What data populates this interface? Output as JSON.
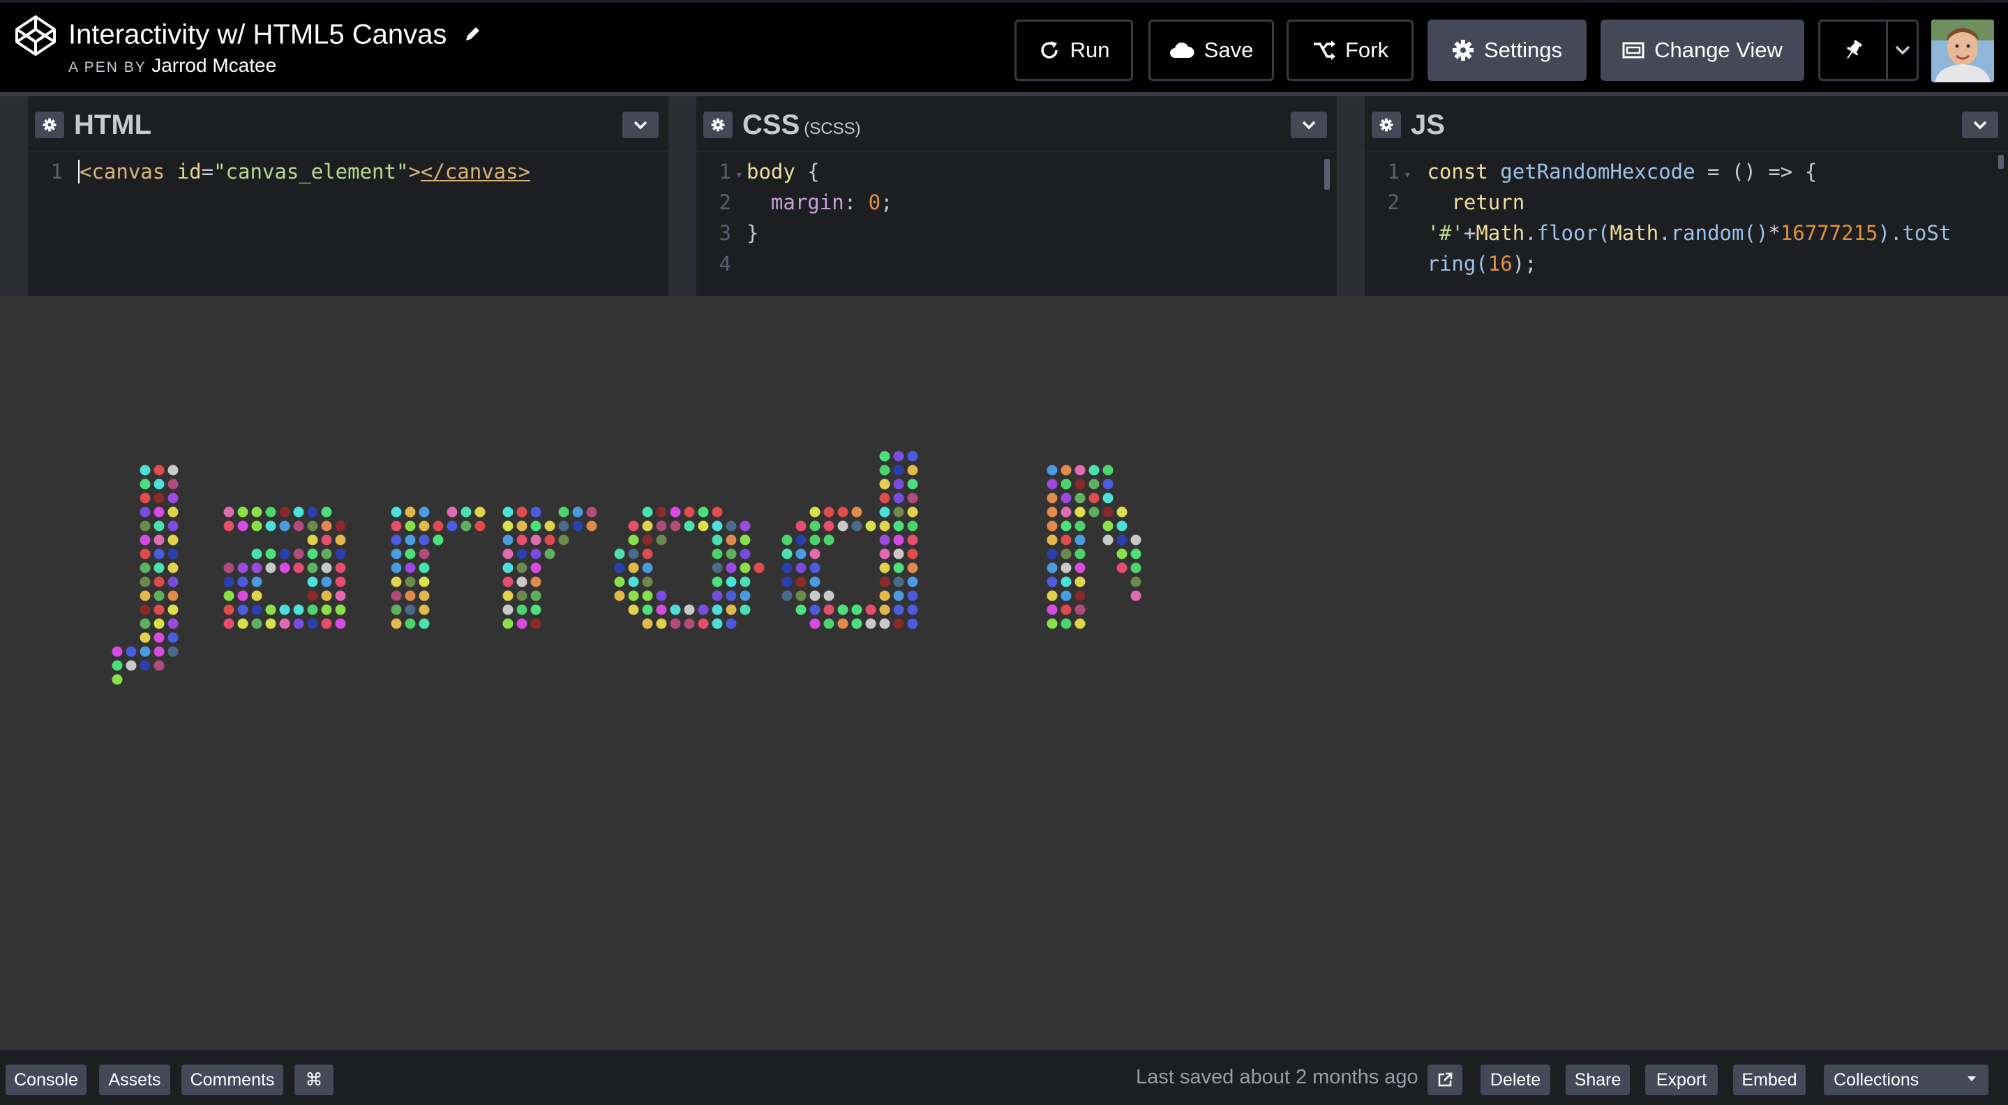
{
  "header": {
    "title": "Interactivity w/ HTML5 Canvas",
    "byline_prefix": "A PEN BY",
    "author": "Jarrod Mcatee",
    "buttons": {
      "run": "Run",
      "save": "Save",
      "fork": "Fork",
      "settings": "Settings",
      "change_view": "Change View"
    }
  },
  "editors": {
    "html": {
      "title": "HTML",
      "lines": [
        {
          "n": "1",
          "fold": false
        }
      ],
      "code": {
        "open_tag_start": "<canvas",
        "attr_name": " id",
        "eq": "=",
        "attr_value": "\"canvas_element\"",
        "open_tag_end": ">",
        "close_tag": "</canvas>"
      }
    },
    "css": {
      "title": "CSS",
      "subtitle": "(SCSS)",
      "line_numbers": [
        "1",
        "2",
        "3",
        "4"
      ],
      "code": {
        "selector": "body",
        "brace_open": " {",
        "property": "margin",
        "colon": ": ",
        "value": "0",
        "semi": ";",
        "brace_close": "}"
      }
    },
    "js": {
      "title": "JS",
      "line_numbers": [
        "1",
        "2"
      ],
      "code": {
        "kw_const": "const",
        "fn_name": " getRandomHexcode",
        "assign": " = () => {",
        "kw_return": "return",
        "str_hash": "'#'",
        "plus": "+",
        "math1": "Math",
        "floor": ".floor(",
        "math2": "Math",
        "random": ".random()",
        "times": "*",
        "num": "16777215",
        "tostr_a": ").toSt",
        "tostr_b": "ring(",
        "radix": "16",
        "end": ");"
      }
    }
  },
  "preview": {
    "canvas_text": "Jarrod M.",
    "background": "#333333",
    "dot_palette": [
      "#e84d6b",
      "#4dd36b",
      "#4b5ce0",
      "#e0d24b",
      "#9b4be0",
      "#4be0d8",
      "#e08a4b",
      "#d84be0",
      "#8ae04b",
      "#4b9be0",
      "#e04b4b",
      "#4be07a",
      "#c9c9c9",
      "#7a4be0",
      "#e0b84b",
      "#4be0b0",
      "#b04b7a",
      "#6b8a4b",
      "#e06bb0",
      "#4b6b8a",
      "#d8e04b",
      "#2a3fb0",
      "#8a2a2a",
      "#5fb05f"
    ]
  },
  "footer": {
    "console": "Console",
    "assets": "Assets",
    "comments": "Comments",
    "keys": "⌘",
    "last_saved": "Last saved about 2 months ago",
    "delete": "Delete",
    "share": "Share",
    "export": "Export",
    "embed": "Embed",
    "collections": "Collections"
  },
  "colors": {
    "header_bg": "#000000",
    "button_bg": "#444857",
    "editor_bg": "#1d1e22",
    "preview_bg": "#333333"
  }
}
